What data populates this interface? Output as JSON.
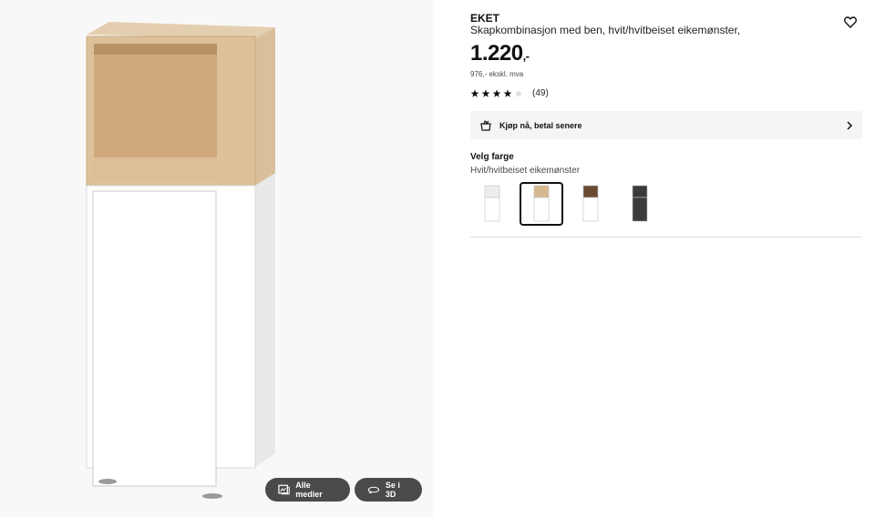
{
  "product": {
    "brand": "EKET",
    "description": "Skapkombinasjon med ben, hvit/hvitbeiset eikemønster,",
    "price_main": "1.220",
    "price_suffix": ",-",
    "price_excl_vat": "976,- ekskl. mva",
    "rating_stars": 4,
    "rating_max": 5,
    "review_count": "(49)"
  },
  "payment": {
    "label": "Kjøp nå, betal senere"
  },
  "color_picker": {
    "title": "Velg farge",
    "selected_label": "Hvit/hvitbeiset eikemønster",
    "options": [
      {
        "name": "white",
        "top": "#ededeb",
        "bottom": "#ffffff"
      },
      {
        "name": "white-oak",
        "top": "#d8b890",
        "bottom": "#ffffff",
        "selected": true
      },
      {
        "name": "walnut-white",
        "top": "#6b4a33",
        "bottom": "#ffffff"
      },
      {
        "name": "dark-grey",
        "top": "#3d3b39",
        "bottom": "#3d3b39"
      }
    ]
  },
  "gallery": {
    "all_media_label": "Alle medier",
    "view_3d_label": "Se i 3D"
  },
  "icons": [
    "heart-icon",
    "klarna-bag-icon",
    "chevron-right-icon",
    "gallery-icon",
    "3d-icon",
    "star-icon"
  ],
  "colors": {
    "accent": "#111111",
    "button_bg": "#4a4a4a",
    "panel_bg": "#f5f5f5"
  }
}
